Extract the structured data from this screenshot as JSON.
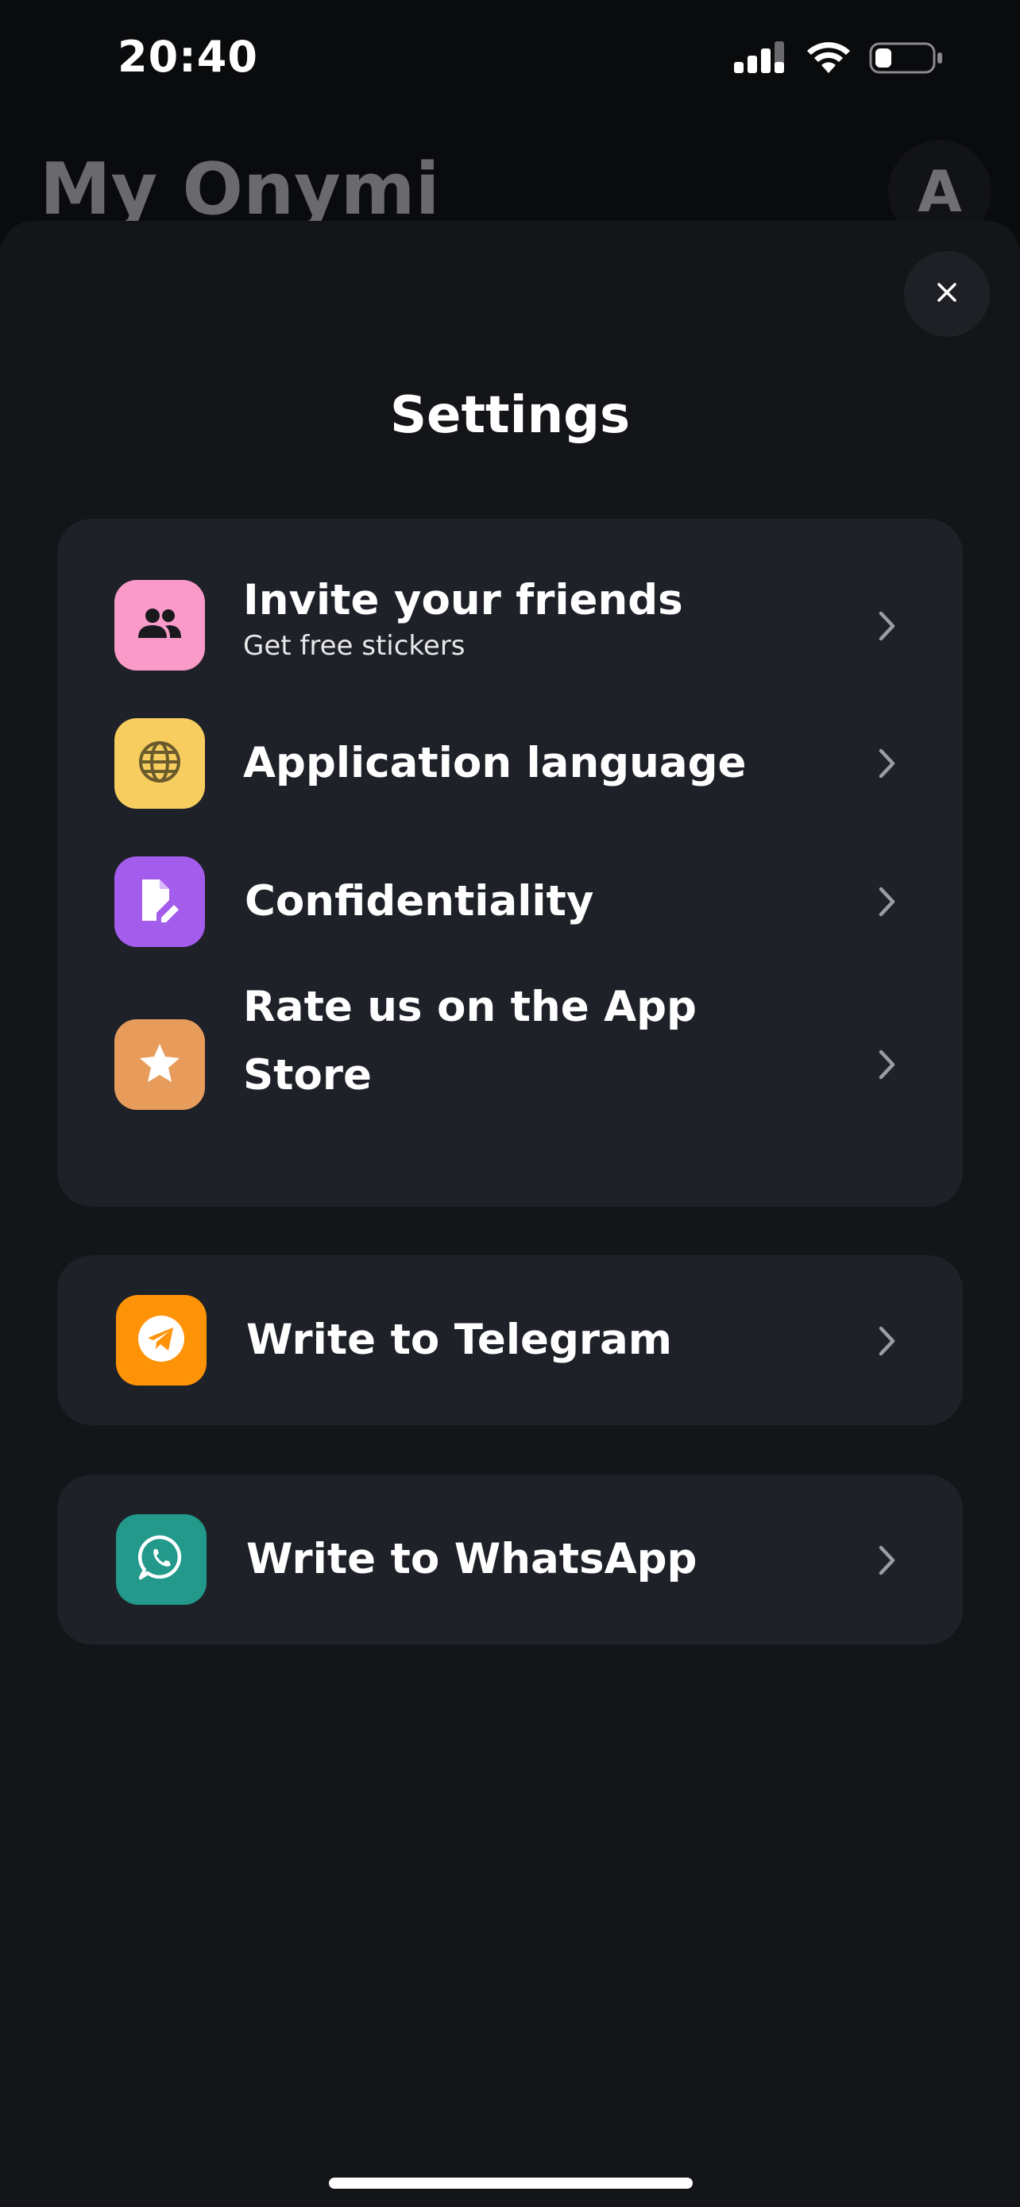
{
  "status_bar": {
    "time": "20:40"
  },
  "background": {
    "title": "My Onymi",
    "avatar_letter": "A"
  },
  "sheet": {
    "title": "Settings",
    "close_icon": "close-icon"
  },
  "main_card": {
    "items": [
      {
        "label": "Invite your friends",
        "sublabel": "Get free stickers",
        "icon": "people-icon",
        "color": "#f99ac8"
      },
      {
        "label": "Application language",
        "icon": "globe-icon",
        "color": "#f6cd5e"
      },
      {
        "label": "Confidentiality",
        "icon": "document-edit-icon",
        "color": "#a45cec"
      },
      {
        "label_line1": "Rate us on the App",
        "label_line2": "Store",
        "icon": "star-icon",
        "color": "#e89c5c"
      }
    ]
  },
  "telegram_card": {
    "label": "Write to Telegram",
    "icon": "telegram-icon",
    "color": "#ff9308"
  },
  "whatsapp_card": {
    "label": "Write to WhatsApp",
    "icon": "whatsapp-icon",
    "color": "#22998a"
  },
  "colors": {
    "background": "#0a0b0d",
    "sheet": "#131519",
    "card": "#1f2129",
    "chevron": "#9c9da3"
  }
}
